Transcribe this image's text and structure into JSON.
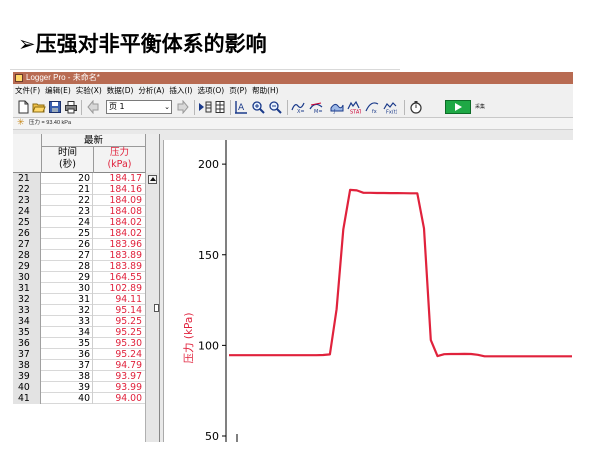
{
  "slide": {
    "title": "➢压强对非平衡体系的影响"
  },
  "app": {
    "title": "Logger Pro - 未命名*",
    "menu": [
      "文件(F)",
      "编辑(E)",
      "实验(X)",
      "数据(D)",
      "分析(A)",
      "插入(I)",
      "选项(O)",
      "页(P)",
      "帮助(H)"
    ],
    "page_select": "页 1",
    "collect_label": "采集",
    "meter": "压力 = 93.40 kPa",
    "icons": [
      "new-file-icon",
      "open-folder-icon",
      "save-icon",
      "print-icon",
      "back-page-icon",
      "next-page-icon",
      "data-browser-icon",
      "autoscale-icon",
      "zoom-in-icon",
      "zoom-out-icon",
      "examine-icon",
      "tangent-icon",
      "integral-icon",
      "statistics-icon",
      "curve-fit-icon",
      "linear-fit-icon",
      "stopwatch-icon",
      "collect-icon"
    ]
  },
  "table": {
    "group_header": "最新",
    "col_time": "时间\n(秒)",
    "col_pressure": "压力\n(kPa)",
    "rows": [
      {
        "n": "21",
        "t": "20",
        "p": "184.17"
      },
      {
        "n": "22",
        "t": "21",
        "p": "184.16"
      },
      {
        "n": "23",
        "t": "22",
        "p": "184.09"
      },
      {
        "n": "24",
        "t": "23",
        "p": "184.08"
      },
      {
        "n": "25",
        "t": "24",
        "p": "184.02"
      },
      {
        "n": "26",
        "t": "25",
        "p": "184.02"
      },
      {
        "n": "27",
        "t": "26",
        "p": "183.96"
      },
      {
        "n": "28",
        "t": "27",
        "p": "183.89"
      },
      {
        "n": "29",
        "t": "28",
        "p": "183.89"
      },
      {
        "n": "30",
        "t": "29",
        "p": "164.55"
      },
      {
        "n": "31",
        "t": "30",
        "p": "102.89"
      },
      {
        "n": "32",
        "t": "31",
        "p": "94.11"
      },
      {
        "n": "33",
        "t": "32",
        "p": "95.14"
      },
      {
        "n": "34",
        "t": "33",
        "p": "95.25"
      },
      {
        "n": "35",
        "t": "34",
        "p": "95.25"
      },
      {
        "n": "36",
        "t": "35",
        "p": "95.30"
      },
      {
        "n": "37",
        "t": "36",
        "p": "95.24"
      },
      {
        "n": "38",
        "t": "37",
        "p": "94.79"
      },
      {
        "n": "39",
        "t": "38",
        "p": "93.97"
      },
      {
        "n": "40",
        "t": "39",
        "p": "93.99"
      },
      {
        "n": "41",
        "t": "40",
        "p": "94.00"
      }
    ]
  },
  "chart_data": {
    "type": "line",
    "title": "",
    "xlabel": "",
    "ylabel": "压力 (kPa)",
    "ylim": [
      50,
      210
    ],
    "yticks": [
      "200",
      "150",
      "100",
      "50"
    ],
    "line_color": "#e0223c",
    "series": [
      {
        "values": [
          94.6,
          94.6,
          94.6,
          94.6,
          94.6,
          94.6,
          94.6,
          94.6,
          94.6,
          94.6,
          94.6,
          94.6,
          94.6,
          94.6,
          94.7,
          95,
          120,
          164,
          185.8,
          185.5,
          184.17,
          184.16,
          184.09,
          184.08,
          184.02,
          184.02,
          183.96,
          183.89,
          183.89,
          164.55,
          102.89,
          94.11,
          95.14,
          95.25,
          95.25,
          95.3,
          95.24,
          94.79,
          93.97,
          93.99,
          94.0,
          94.0,
          94.0,
          94.0,
          94.0,
          94.0,
          94.0,
          94.0,
          94.0,
          94.0,
          94.0,
          94.0
        ]
      }
    ]
  }
}
